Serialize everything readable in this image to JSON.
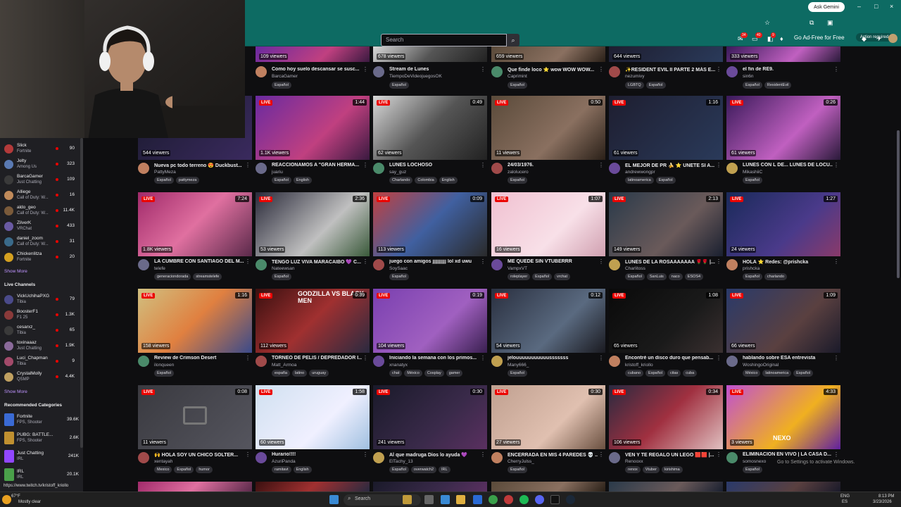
{
  "browser": {
    "gemini_label": "Ask Gemini",
    "action_required": "Action required",
    "window_controls": [
      "–",
      "□",
      "×"
    ]
  },
  "nav": {
    "search_placeholder": "Search",
    "ad_free": "Go Ad-Free for Free",
    "badges": [
      "34",
      "40",
      "9"
    ]
  },
  "sidebar": {
    "followed": [
      {
        "name": "Slick",
        "game": "Fortnite",
        "count": "90",
        "color": "#b33a3a"
      },
      {
        "name": "Jelty",
        "game": "Among Us",
        "count": "323",
        "color": "#5a7ab3"
      },
      {
        "name": "BarcaGamer",
        "game": "Just Chatting",
        "count": "109",
        "color": "#3a3a3a"
      },
      {
        "name": "Alliege",
        "game": "Call of Duty: W...",
        "count": "16",
        "color": "#c08a5a"
      },
      {
        "name": "aldo_geo",
        "game": "Call of Duty: W...",
        "count": "11.4K",
        "color": "#7a5a3a"
      },
      {
        "name": "ZilverK",
        "game": "VRChat",
        "count": "433",
        "color": "#6a5aa3"
      },
      {
        "name": "daniel_zoom",
        "game": "Call of Duty: W...",
        "count": "31",
        "color": "#3a6a8a"
      },
      {
        "name": "ChickenIitza",
        "game": "Fortnite",
        "count": "20",
        "color": "#d4a020"
      }
    ],
    "show_more": "Show More",
    "live_header": "Live Channels",
    "live": [
      {
        "name": "VickUchihaPXG",
        "game": "Tibia",
        "count": "79",
        "color": "#4a4a8a"
      },
      {
        "name": "BoosterF1",
        "game": "F1 25",
        "count": "1.3K",
        "color": "#8a3a3a"
      },
      {
        "name": "cesarxz_",
        "game": "Tibia",
        "count": "65",
        "color": "#3a3a3a"
      },
      {
        "name": "toxinaaaz",
        "game": "Just Chatting",
        "count": "1.9K",
        "color": "#8a6a9a"
      },
      {
        "name": "Luci_Chapman",
        "game": "Tibia",
        "count": "9",
        "color": "#a34a6a"
      },
      {
        "name": "CrystalMolly",
        "game": "QSMP",
        "count": "4.4K",
        "color": "#c0a060"
      }
    ],
    "show_more2": "Show More",
    "cat_header": "Recommended Categories",
    "categories": [
      {
        "name": "Fortnite",
        "tag": "FPS, Shooter",
        "count": "39.6K",
        "color": "#3a6ad4"
      },
      {
        "name": "PUBG: BATTLE...",
        "tag": "FPS, Shooter",
        "count": "2.6K",
        "color": "#c09030"
      },
      {
        "name": "Just Chatting",
        "tag": "IRL",
        "count": "241K",
        "color": "#9147ff"
      },
      {
        "name": "IRL",
        "tag": "IRL",
        "count": "20.1K",
        "color": "#4aa04a"
      }
    ]
  },
  "top_row": [
    {
      "viewers": "109 viewers",
      "title": "Como hoy suelo descansar se susc...",
      "channel": "BarcaGamer",
      "tags": [
        "Español"
      ]
    },
    {
      "viewers": "678 viewers",
      "title": "Stream de Lunes",
      "channel": "TiempoDeVideojuegosOK",
      "tags": [
        "Español"
      ]
    },
    {
      "viewers": "659 viewers",
      "title": "Que finde loco ⭐ wow WOW WOW...",
      "channel": "Caprimint",
      "tags": [
        "Español"
      ]
    },
    {
      "viewers": "644 viewers",
      "title": "✨RESIDENT EVIL II PARTE 2 MÁS E...",
      "channel": "nezumivy",
      "tags": [
        "LGBTQ",
        "Español"
      ]
    },
    {
      "viewers": "333 viewers",
      "title": "el fin de RE9.",
      "channel": "sin6n",
      "tags": [
        "Español",
        "ResidentEvil"
      ]
    }
  ],
  "rows": [
    [
      {
        "duration": "",
        "viewers": "544 viewers",
        "title": "Nueva pc todo terreno 😍 Duckbust...",
        "channel": "PattyMeza",
        "tags": [
          "Español",
          "pattymeza"
        ],
        "live": false
      },
      {
        "duration": "1:44",
        "viewers": "1.1K viewers",
        "title": "REACCIONAMOS A \"GRAN HERMA...",
        "channel": "juariu",
        "tags": [
          "Español",
          "English"
        ],
        "live": true
      },
      {
        "duration": "0:49",
        "viewers": "62 viewers",
        "title": "LUNES LOCHOSO",
        "channel": "say_guz",
        "tags": [
          "Charlando",
          "Colombia",
          "English"
        ],
        "live": true
      },
      {
        "duration": "0:50",
        "viewers": "11 viewers",
        "title": "24/03/1976.",
        "channel": "zalolucero",
        "tags": [
          "Español"
        ],
        "live": true
      },
      {
        "duration": "1:16",
        "viewers": "61 viewers",
        "title": "EL MEJOR DE PR 🍌 ⭐ UNETE SI A...",
        "channel": "andrewwongpr",
        "tags": [
          "latinoamerica",
          "Español"
        ],
        "live": true
      },
      {
        "duration": "0:26",
        "viewers": "61 viewers",
        "title": "LUNES CON L DE... LUNES DE LOCU...",
        "channel": "MikashiiC",
        "tags": [
          "Español"
        ],
        "live": true
      }
    ],
    [
      {
        "duration": "7:24",
        "viewers": "1.8K viewers",
        "title": "LA CUMBRE CON SANTIAGO DEL M...",
        "channel": "telefe",
        "tags": [
          "generaciondorada",
          "streamstelefe"
        ],
        "live": true
      },
      {
        "duration": "2:36",
        "viewers": "53 viewers",
        "title": "TENGO LUZ VIVA MARACAIBO 💜 C...",
        "channel": "Nateewsan",
        "tags": [
          "Español"
        ],
        "live": true
      },
      {
        "duration": "0:09",
        "viewers": "113 viewers",
        "title": "juego con amigos jjjjjjjjjj lol xd uwu",
        "channel": "SoySaac",
        "tags": [
          "Español"
        ],
        "live": true
      },
      {
        "duration": "1:07",
        "viewers": "16 viewers",
        "title": "ME QUEDE SIN VTUBERRR",
        "channel": "VampxVT",
        "tags": [
          "roleplayer",
          "Español",
          "vrchat"
        ],
        "live": true
      },
      {
        "duration": "2:13",
        "viewers": "149 viewers",
        "title": "LUNES DE LA ROSAAAAAAA 🌹🌹 |...",
        "channel": "Charlitoss",
        "tags": [
          "Español",
          "SanLuis",
          "naco",
          "ESOS4"
        ],
        "live": true
      },
      {
        "duration": "1:27",
        "viewers": "24 viewers",
        "title": "HOLA ⭐ Redes: @prishcka",
        "channel": "prishcka",
        "tags": [
          "Español",
          "charlando"
        ],
        "live": true
      }
    ],
    [
      {
        "duration": "1:16",
        "viewers": "158 viewers",
        "title": "Review de Crimson Desert",
        "channel": "ilonqueen",
        "tags": [
          "Español"
        ],
        "live": true
      },
      {
        "duration": "0:39",
        "viewers": "112 viewers",
        "title": "TORNEO DE PELIS / DEPREDADOR I...",
        "channel": "Matt_Armoa",
        "tags": [
          "españa",
          "latino",
          "uruguay"
        ],
        "live": true
      },
      {
        "duration": "0:19",
        "viewers": "104 viewers",
        "title": "Iniciando la semana con los primos...",
        "channel": "xnanatyx",
        "tags": [
          "chat",
          "México",
          "Cosplay",
          "gamer"
        ],
        "live": true
      },
      {
        "duration": "0:12",
        "viewers": "54 viewers",
        "title": "jelouuuuuuuuuuusssssss",
        "channel": "Many666_",
        "tags": [
          "Español"
        ],
        "live": true
      },
      {
        "duration": "1:08",
        "viewers": "65 viewers",
        "title": "Encontré un disco duro que pensab...",
        "channel": "kristoff_kriollo",
        "tags": [
          "cubano",
          "Español",
          "citas",
          "cuba"
        ],
        "live": true
      },
      {
        "duration": "1:09",
        "viewers": "66 viewers",
        "title": "hablando sobre ESA entrevista",
        "channel": "WoshingoOriginal",
        "tags": [
          "México",
          "latinoamerica",
          "Español"
        ],
        "live": true
      }
    ],
    [
      {
        "duration": "0:08",
        "viewers": "11 viewers",
        "title": "🙌 HOLA SOY UN CHICO SOLTER...",
        "channel": "xentayah",
        "tags": [
          "Mexico",
          "Español",
          "humor"
        ],
        "live": true
      },
      {
        "duration": "1:58",
        "viewers": "60 viewers",
        "title": "Hurario!!!!",
        "channel": "AzuriPanda",
        "tags": [
          "ramitavt",
          "English"
        ],
        "live": true
      },
      {
        "duration": "0:30",
        "viewers": "241 viewers",
        "title": "Al que madruga Dios lo ayuda 💜",
        "channel": "ElTachy_13",
        "tags": [
          "Español",
          "overwatch2",
          "IRL"
        ],
        "live": true
      },
      {
        "duration": "0:30",
        "viewers": "27 viewers",
        "title": "ENCERRADA EN MIS 4 PAREDES 💀 ...",
        "channel": "CherryJulss_",
        "tags": [
          "Español"
        ],
        "live": true
      },
      {
        "duration": "0:34",
        "viewers": "106 viewers",
        "title": "VEN Y TE REGALO UN LEGO 🟥🟥 |...",
        "channel": "Renooxx",
        "tags": [
          "renox",
          "Vtuber",
          "kirishima"
        ],
        "live": true
      },
      {
        "duration": "4:33",
        "viewers": "3 viewers",
        "title": "ELIMINACIÓN EN VIVO | LA CASA D...",
        "channel": "somosnexo",
        "tags": [
          "Español"
        ],
        "live": true
      }
    ]
  ],
  "thumb_texts": {
    "godzilla": "GODZILLA VS BLACK MEN",
    "nexo": "NEXO"
  },
  "watermark": "Go to Settings to activate Windows.",
  "status_url": "https://www.twitch.tv/kristoff_kriollo",
  "taskbar": {
    "weather": "67°F",
    "weather2": "Mostly clear",
    "search": "Search",
    "lang1": "ENG",
    "lang2": "ES",
    "time": "8:13 PM",
    "date": "3/23/2026"
  }
}
